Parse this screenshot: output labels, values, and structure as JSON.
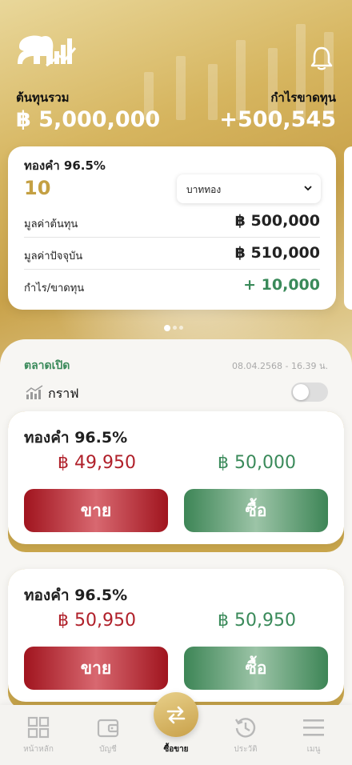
{
  "header": {
    "total_cost_label": "ต้นทุนรวม",
    "total_cost_value": "฿ 5,000,000",
    "profit_loss_label": "กำไรขาดทุน",
    "profit_loss_value": "+500,545"
  },
  "portfolio_card": {
    "title": "ทองคำ 96.5%",
    "quantity": "10",
    "unit_select": "บาททอง",
    "rows": [
      {
        "label": "มูลค่าต้นทุน",
        "value": "฿ 500,000"
      },
      {
        "label": "มูลค่าปัจจุบัน",
        "value": "฿ 510,000"
      },
      {
        "label": "กำไร/ขาดทุน",
        "value": "+ 10,000"
      }
    ],
    "page_count": 3,
    "active_page": 1
  },
  "market": {
    "status": "ตลาดเปิด",
    "timestamp": "08.04.2568 - 16.39 น.",
    "graph_label": "กราฟ",
    "graph_toggle_on": false
  },
  "quotes": [
    {
      "title": "ทองคำ 96.5%",
      "sell_price": "฿ 49,950",
      "buy_price": "฿ 50,000",
      "sell_label": "ขาย",
      "buy_label": "ซื้อ"
    },
    {
      "title": "ทองคำ 96.5%",
      "sell_price": "฿ 50,950",
      "buy_price": "฿ 50,950",
      "sell_label": "ขาย",
      "buy_label": "ซื้อ"
    }
  ],
  "nav": {
    "home": "หน้าหลัก",
    "account": "บัญชี",
    "trade": "ซื้อขาย",
    "history": "ประวัติ",
    "menu": "เมนู"
  },
  "colors": {
    "gold": "#c9a24a",
    "sell_red": "#b0202a",
    "buy_green": "#3a8a5a"
  }
}
